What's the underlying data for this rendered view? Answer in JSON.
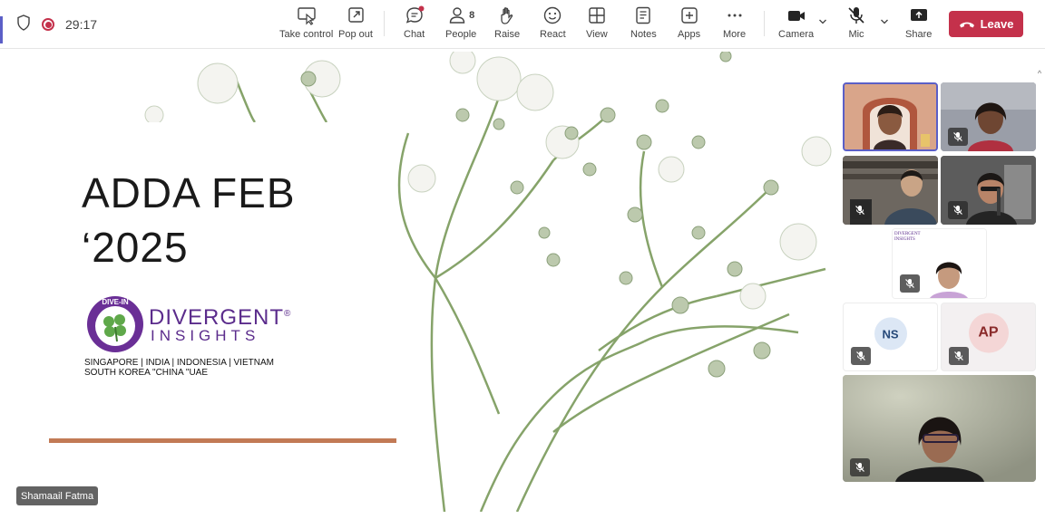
{
  "meeting": {
    "timer": "29:17"
  },
  "toolbar": {
    "take_control": "Take control",
    "pop_out": "Pop out",
    "chat": "Chat",
    "people": "People",
    "people_count": "8",
    "raise": "Raise",
    "react": "React",
    "view": "View",
    "notes": "Notes",
    "apps": "Apps",
    "more": "More",
    "camera": "Camera",
    "mic": "Mic",
    "share": "Share",
    "leave": "Leave"
  },
  "slide": {
    "title_line1": "ADDA FEB",
    "title_line2": "‘2025",
    "logo_badge": "DIVE-IN",
    "brand_name": "DIVERGENT",
    "brand_registered": "®",
    "brand_sub": "INSIGHTS",
    "locations_line1": "SINGAPORE | INDIA | INDONESIA | VIETNAM",
    "locations_line2": "SOUTH KOREA \"CHINA \"UAE"
  },
  "presenter": {
    "name": "Shamaail Fatma"
  },
  "participants": {
    "ns_initials": "NS",
    "ap_initials": "AP",
    "mini_slide_line1": "DIVERGENT",
    "mini_slide_line2": "INSIGHTS"
  },
  "colors": {
    "leave": "#c4314b",
    "brand_purple": "#5b2c8c",
    "active_speaker_border": "#5b5fc7",
    "slide_bar": "#c27a55"
  }
}
